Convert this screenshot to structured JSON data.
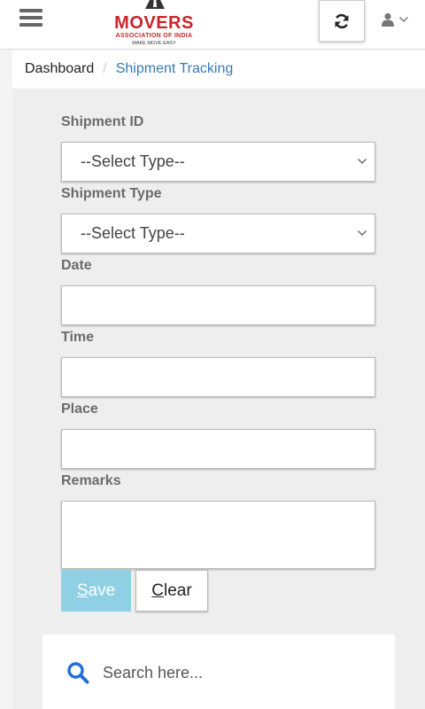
{
  "header": {
    "logo_main": "MOVERS",
    "logo_sub": "ASSOCIATION OF INDIA",
    "logo_tagline": "MAKE MOVE EASY",
    "logo_color": "#c9262a"
  },
  "breadcrumb": {
    "home": "Dashboard",
    "separator": "/",
    "current": "Shipment Tracking",
    "current_color": "#337ab7"
  },
  "form": {
    "shipment_id_label": "Shipment ID",
    "shipment_id_value": "--Select Type--",
    "shipment_type_label": "Shipment Type",
    "shipment_type_value": "--Select Type--",
    "date_label": "Date",
    "date_value": "",
    "time_label": "Time",
    "time_value": "",
    "place_label": "Place",
    "place_value": "",
    "remarks_label": "Remarks",
    "remarks_value": ""
  },
  "buttons": {
    "save_first": "S",
    "save_rest": "ave",
    "clear_first": "C",
    "clear_rest": "lear",
    "save_color": "#8fd0e4"
  },
  "search": {
    "placeholder": "Search here...",
    "icon_color": "#1f6fd6"
  },
  "icons": {
    "menu": "hamburger-icon",
    "refresh": "refresh-icon",
    "user": "user-icon",
    "search": "search-icon"
  }
}
